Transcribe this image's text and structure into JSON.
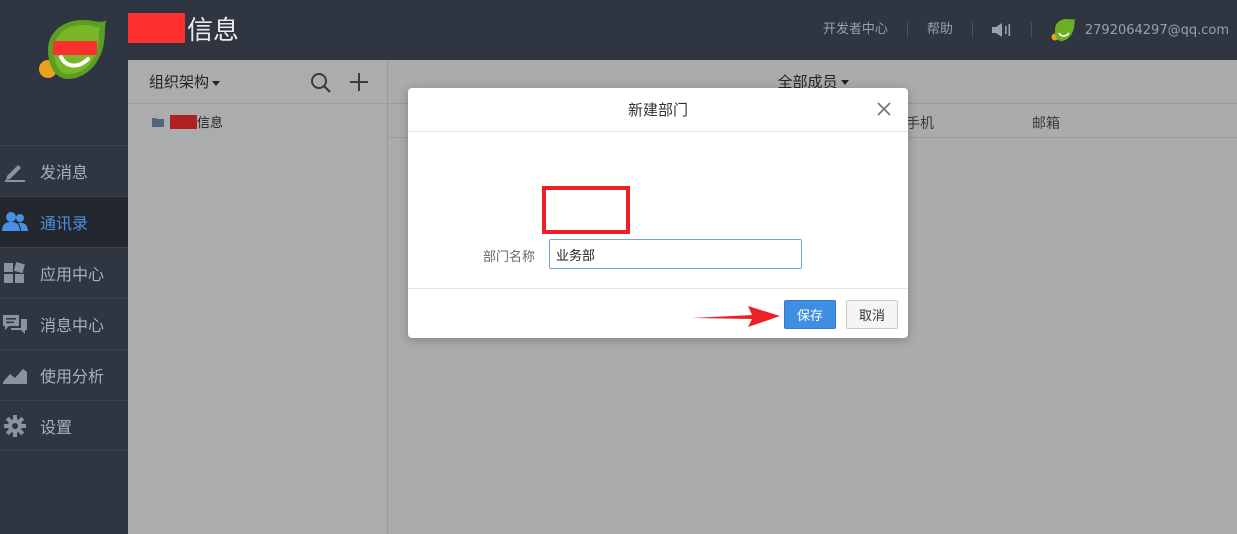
{
  "header": {
    "brand_title": "信息",
    "links": [
      "开发者中心",
      "帮助"
    ],
    "account_email": "2792064297@qq.com"
  },
  "nav": {
    "items": [
      {
        "label": "发消息",
        "icon": "compose-icon",
        "active": false
      },
      {
        "label": "通讯录",
        "icon": "contacts-icon",
        "active": true
      },
      {
        "label": "应用中心",
        "icon": "apps-icon",
        "active": false
      },
      {
        "label": "消息中心",
        "icon": "messages-icon",
        "active": false
      },
      {
        "label": "使用分析",
        "icon": "chart-icon",
        "active": false
      },
      {
        "label": "设置",
        "icon": "gear-icon",
        "active": false
      }
    ]
  },
  "org": {
    "title": "组织架构",
    "tree_item": "信息"
  },
  "members": {
    "filter": "全部成员",
    "columns": {
      "mobile": "手机",
      "email": "邮箱"
    }
  },
  "dialog": {
    "title": "新建部门",
    "field_label": "部门名称",
    "field_value": "业务部",
    "save_label": "保存",
    "cancel_label": "取消"
  },
  "colors": {
    "accent": "#3f8ee0",
    "nav_bg": "#2f3541",
    "annotation_red": "#ee2026"
  }
}
